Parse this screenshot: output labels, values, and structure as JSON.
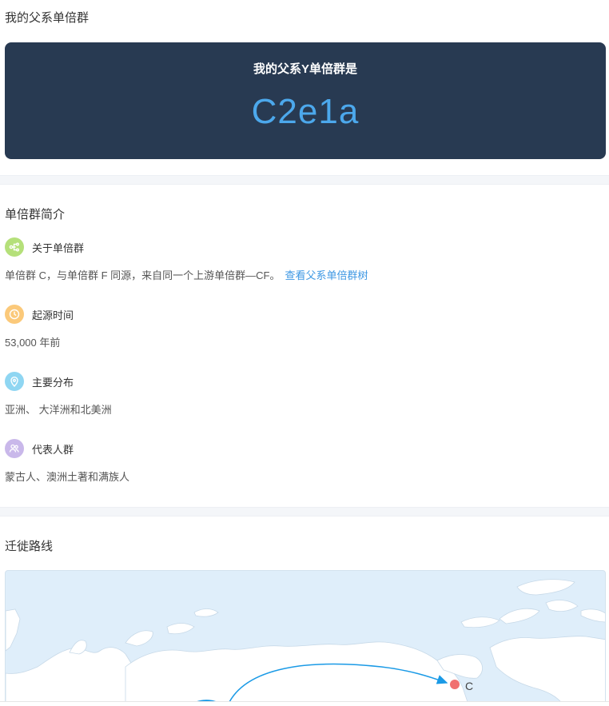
{
  "header": {
    "title": "我的父系单倍群"
  },
  "result": {
    "label": "我的父系Y单倍群是",
    "value": "C2e1a"
  },
  "intro": {
    "title": "单倍群简介",
    "items": [
      {
        "icon": "branch-icon",
        "color": "#b5e07a",
        "title": "关于单倍群",
        "text": "单倍群 C，与单倍群 F 同源，来自同一个上游单倍群—CF。",
        "link": "查看父系单倍群树"
      },
      {
        "icon": "clock-icon",
        "color": "#fbc97a",
        "title": "起源时间",
        "text": "53,000 年前"
      },
      {
        "icon": "location-pin-icon",
        "color": "#8fd6f2",
        "title": "主要分布",
        "text": "亚洲、 大洋洲和北美洲"
      },
      {
        "icon": "people-icon",
        "color": "#c9b8ea",
        "title": "代表人群",
        "text": "蒙古人、澳洲土著和满族人"
      }
    ]
  },
  "migration": {
    "title": "迁徙路线",
    "marker_label": "C"
  },
  "colors": {
    "card_bg": "#283a52",
    "accent": "#4ca8ec",
    "link": "#3c97e3",
    "route": "#1a9ae6",
    "marker": "#f07070"
  }
}
